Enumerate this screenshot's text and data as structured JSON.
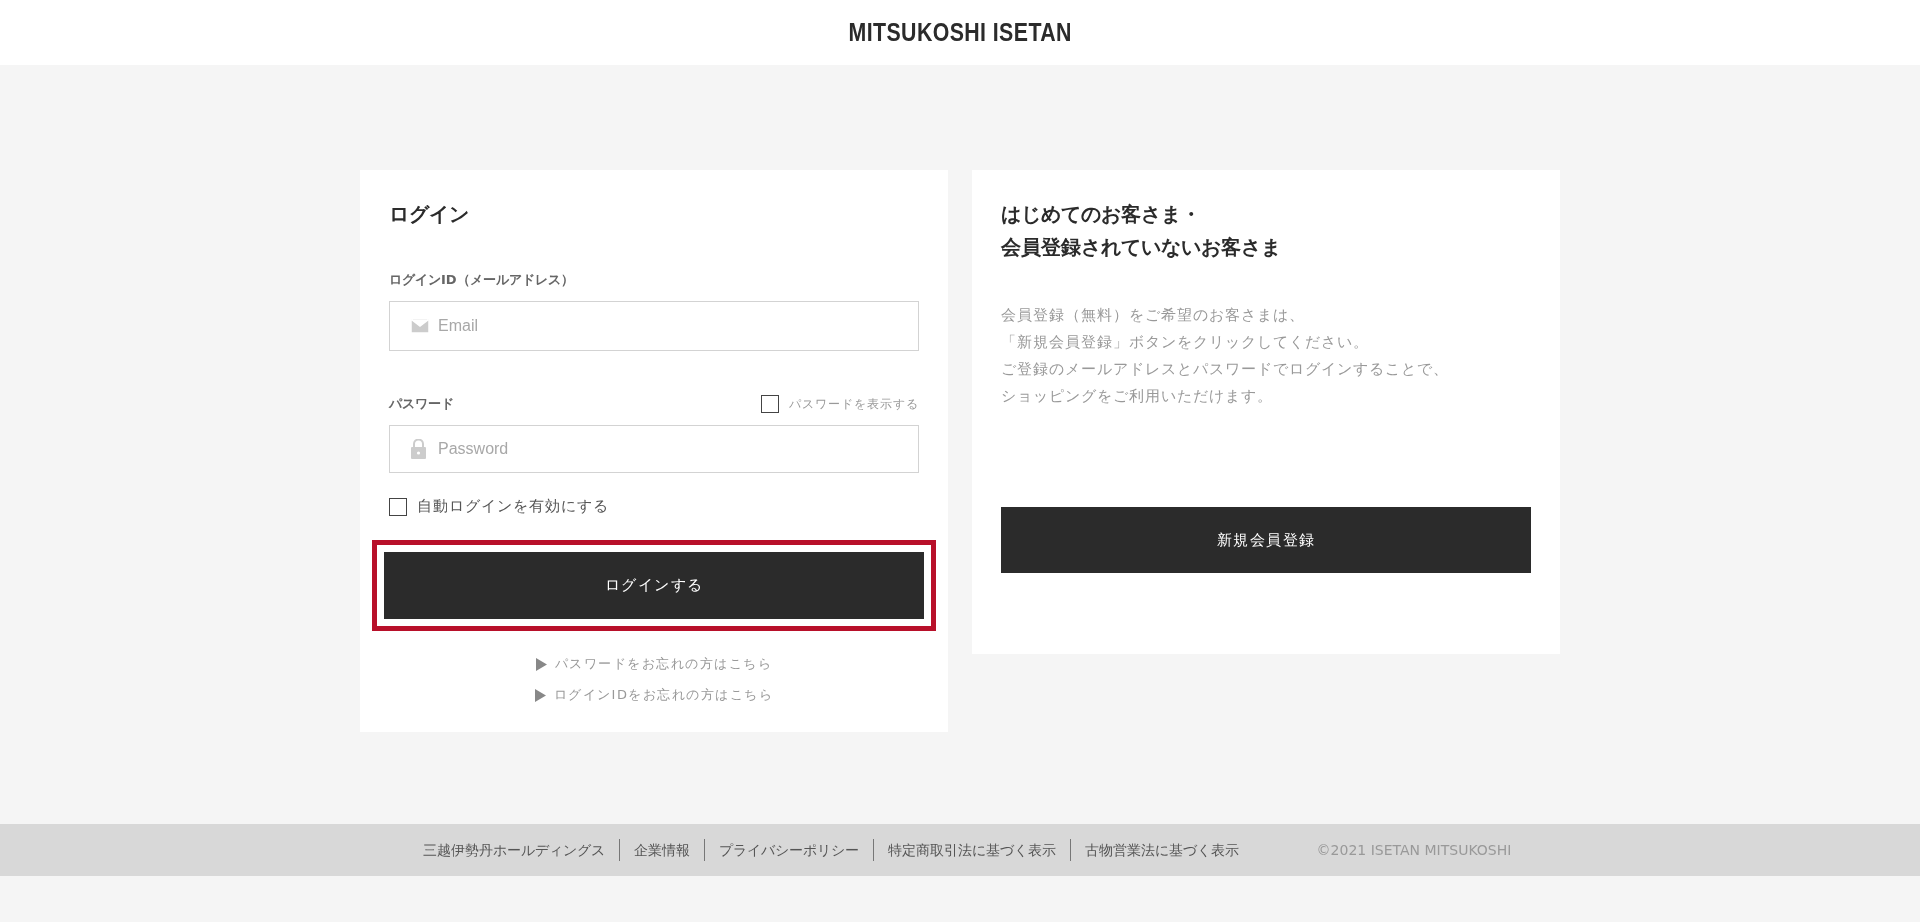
{
  "header": {
    "logo": "MITSUKOSHI ISETAN"
  },
  "login": {
    "title": "ログイン",
    "id_field": {
      "label": "ログインID（メールアドレス）",
      "placeholder": "Email"
    },
    "password_field": {
      "label": "パスワード",
      "placeholder": "Password"
    },
    "show_password": {
      "label": "パスワードを表示する",
      "checked": false
    },
    "auto_login": {
      "label": "自動ログインを有効にする",
      "checked": false
    },
    "submit": {
      "label": "ログインする",
      "highlighted": true
    },
    "links": [
      {
        "label": "パスワードをお忘れの方はこちら"
      },
      {
        "label": "ログインIDをお忘れの方はこちら"
      }
    ]
  },
  "register": {
    "title_lines": [
      "はじめてのお客さま・",
      "会員登録されていないお客さま"
    ],
    "text_lines": [
      "会員登録（無料）をご希望のお客さまは、",
      "「新規会員登録」ボタンをクリックしてください。",
      "ご登録のメールアドレスとパスワードでログインすることで、",
      "ショッピングをご利用いただけます。"
    ],
    "button": "新規会員登録"
  },
  "footer": {
    "links": [
      "三越伊勢丹ホールディングス",
      "企業情報",
      "プライバシーポリシー",
      "特定商取引法に基づく表示",
      "古物営業法に基づく表示"
    ],
    "copyright": "©2021 ISETAN MITSUKOSHI"
  }
}
